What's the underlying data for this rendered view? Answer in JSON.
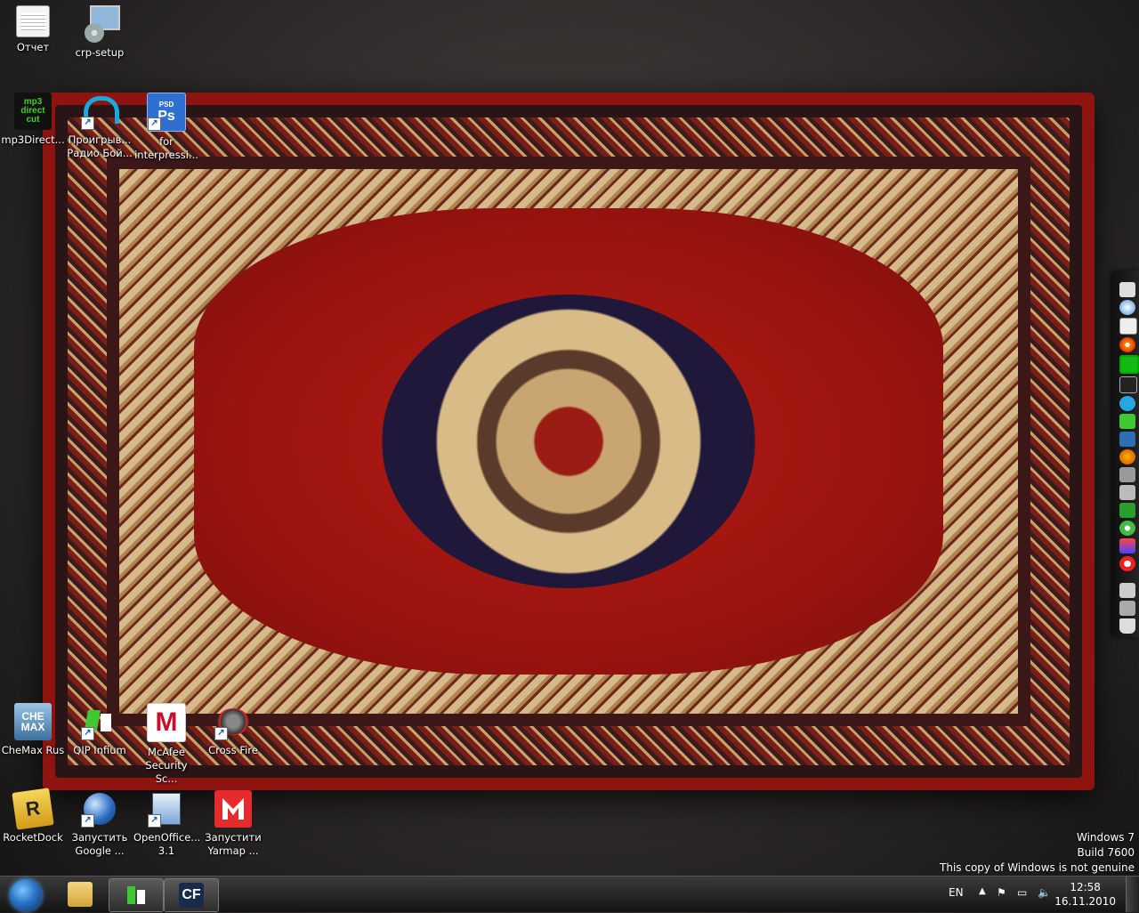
{
  "desktop": {
    "icons": [
      {
        "label": "Отчет"
      },
      {
        "label": "crp-setup"
      },
      {
        "label": "mp3Direct..."
      },
      {
        "label": "Проигрыв...\nРадио Бой..."
      },
      {
        "label": "for\ninterpressi..."
      },
      {
        "label": "CheMax Rus"
      },
      {
        "label": "QIP Infium"
      },
      {
        "label": "McAfee\nSecurity Sc..."
      },
      {
        "label": "Cross Fire"
      },
      {
        "label": "RocketDock"
      },
      {
        "label": "Запустить\nGoogle ..."
      },
      {
        "label": "OpenOffice...\n3.1"
      },
      {
        "label": "Запустити\nYarmap ..."
      }
    ],
    "icon_glyphs": {
      "mp3": "mp3\ndirect\ncut",
      "psd": "PSD",
      "ps": "Ps",
      "chemax": "CHE\nMAX",
      "mcafee": "M",
      "rocketdock": "R",
      "cf": "CF"
    }
  },
  "watermark": {
    "line1": "Windows 7",
    "line2": "Build 7600",
    "line3": "This copy of Windows is not genuine"
  },
  "taskbar": {
    "language": "EN",
    "time": "12:58",
    "date": "16.11.2010",
    "pinned": [
      "explorer-icon",
      "qip-icon",
      "crossfire-icon"
    ],
    "cf_label": "CF"
  },
  "colors": {
    "carpet_red": "#9b140f",
    "taskbar": "#1e1e1e",
    "start_orb": "#2a74c9"
  }
}
